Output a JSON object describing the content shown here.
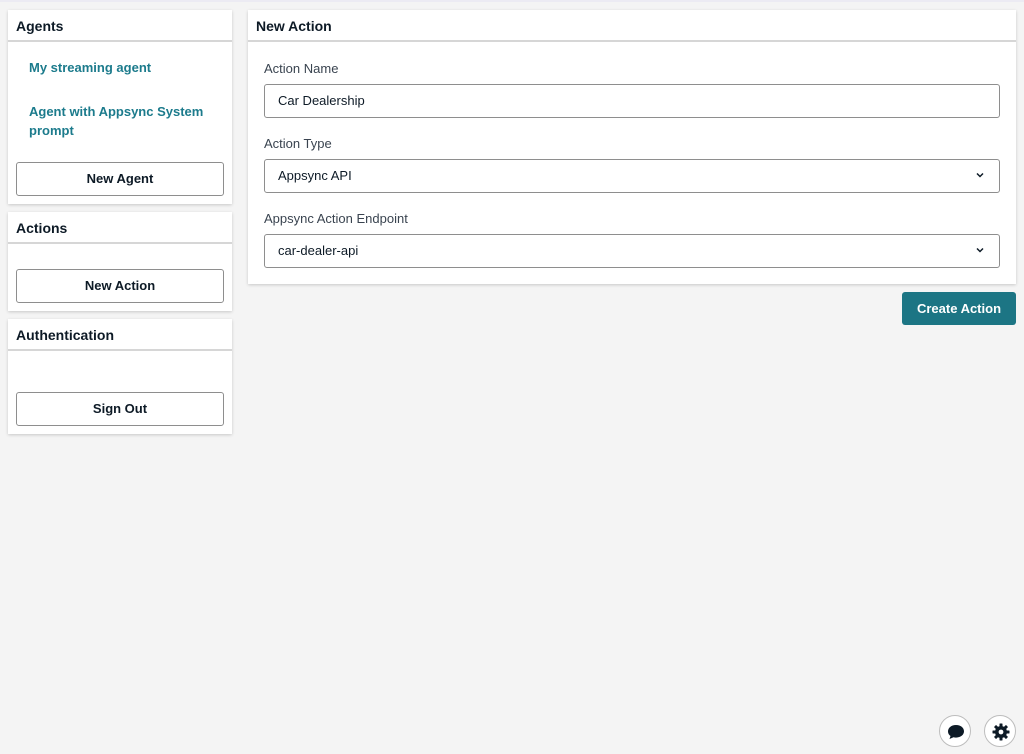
{
  "sidebar": {
    "agents": {
      "title": "Agents",
      "items": [
        {
          "label": "My streaming agent"
        },
        {
          "label": "Agent with Appsync System prompt"
        }
      ],
      "new_button": "New Agent"
    },
    "actions": {
      "title": "Actions",
      "new_button": "New Action"
    },
    "auth": {
      "title": "Authentication",
      "sign_out": "Sign Out"
    }
  },
  "main": {
    "title": "New Action",
    "fields": {
      "name": {
        "label": "Action Name",
        "value": "Car Dealership"
      },
      "type": {
        "label": "Action Type",
        "value": "Appsync API"
      },
      "endpoint": {
        "label": "Appsync Action Endpoint",
        "value": "car-dealer-api"
      }
    },
    "submit": "Create Action"
  },
  "floating": {
    "chat_icon": "chat-bubble-icon",
    "settings_icon": "gear-icon"
  },
  "colors": {
    "accent": "#1c7584",
    "link": "#1c7b8c",
    "background": "#f4f4f4"
  }
}
